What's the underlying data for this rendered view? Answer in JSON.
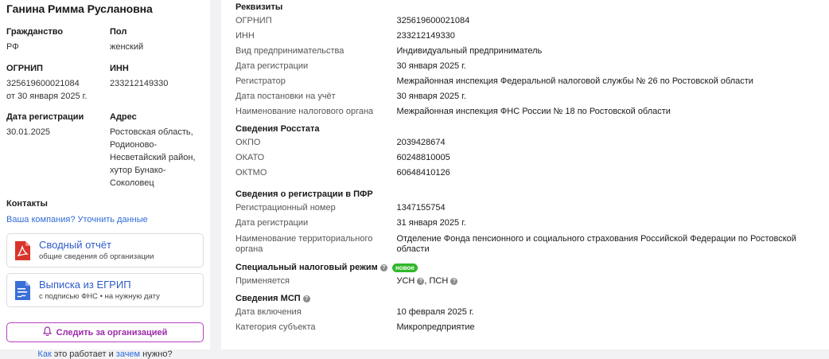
{
  "person": {
    "name": "Ганина Римма Руслановна"
  },
  "info": {
    "citizenship_label": "Гражданство",
    "citizenship_value": "РФ",
    "gender_label": "Пол",
    "gender_value": "женский",
    "ogrnip_label": "ОГРНИП",
    "ogrnip_value": "325619600021084",
    "ogrnip_date": "от 30 января 2025 г.",
    "inn_label": "ИНН",
    "inn_value": "233212149330",
    "regdate_label": "Дата регистрации",
    "regdate_value": "30.01.2025",
    "address_label": "Адрес",
    "address_lines": [
      "Ростовская область,",
      "Родионово-",
      "Несветайский район,",
      "хутор Бунако-",
      "Соколовец"
    ]
  },
  "contacts": {
    "title": "Контакты",
    "link": "Ваша компания? Уточнить данные"
  },
  "cards": [
    {
      "title": "Сводный отчёт",
      "subtitle": "общие сведения об организации"
    },
    {
      "title": "Выписка из ЕГРИП",
      "subtitle": "с подписью ФНС • на нужную дату"
    }
  ],
  "follow_button": "Следить за организацией",
  "howto": {
    "a1": "Как",
    "t1": " это работает и ",
    "a2": "зачем",
    "t2": " нужно?"
  },
  "requisites": {
    "title": "Реквизиты",
    "rows": [
      {
        "k": "ОГРНИП",
        "v": "325619600021084"
      },
      {
        "k": "ИНН",
        "v": "233212149330"
      },
      {
        "k": "Вид предпринимательства",
        "v": "Индивидуальный предприниматель"
      },
      {
        "k": "Дата регистрации",
        "v": "30 января 2025 г."
      },
      {
        "k": "Регистратор",
        "v": "Межрайонная инспекция Федеральной налоговой службы № 26 по Ростовской области"
      },
      {
        "k": "Дата постановки на учёт",
        "v": "30 января 2025 г."
      },
      {
        "k": "Наименование налогового органа",
        "v": "Межрайонная инспекция ФНС России № 18 по Ростовской области"
      }
    ]
  },
  "rosstat": {
    "title": "Сведения Росстата",
    "rows": [
      {
        "k": "ОКПО",
        "v": "2039428674"
      },
      {
        "k": "ОКАТО",
        "v": "60248810005"
      },
      {
        "k": "ОКТМО",
        "v": "60648410126"
      }
    ]
  },
  "pfr": {
    "title": "Сведения о регистрации в ПФР",
    "rows": [
      {
        "k": "Регистрационный номер",
        "v": "1347155754"
      },
      {
        "k": "Дата регистрации",
        "v": "31 января 2025 г."
      },
      {
        "k": "Наименование территориального органа",
        "v": "Отделение Фонда пенсионного и социального страхования Российской Федерации по Ростовской области"
      }
    ]
  },
  "tax_regime": {
    "title": "Специальный налоговый режим",
    "badge": "новое",
    "k": "Применяется",
    "v1": "УСН",
    "v2": ", ПСН"
  },
  "msp": {
    "title": "Сведения МСП",
    "rows": [
      {
        "k": "Дата включения",
        "v": "10 февраля 2025 г."
      },
      {
        "k": "Категория субъекта",
        "v": "Микропредприятие"
      }
    ]
  },
  "icons": {
    "pdf": "pdf-file-icon",
    "doc": "document-signed-icon",
    "bell": "bell-icon",
    "help": "question-icon"
  },
  "colors": {
    "accent": "#9b2aa8",
    "link": "#2f6bd8",
    "badge": "#31b72a",
    "pdf": "#d9342b",
    "doc": "#3b6fd8"
  }
}
